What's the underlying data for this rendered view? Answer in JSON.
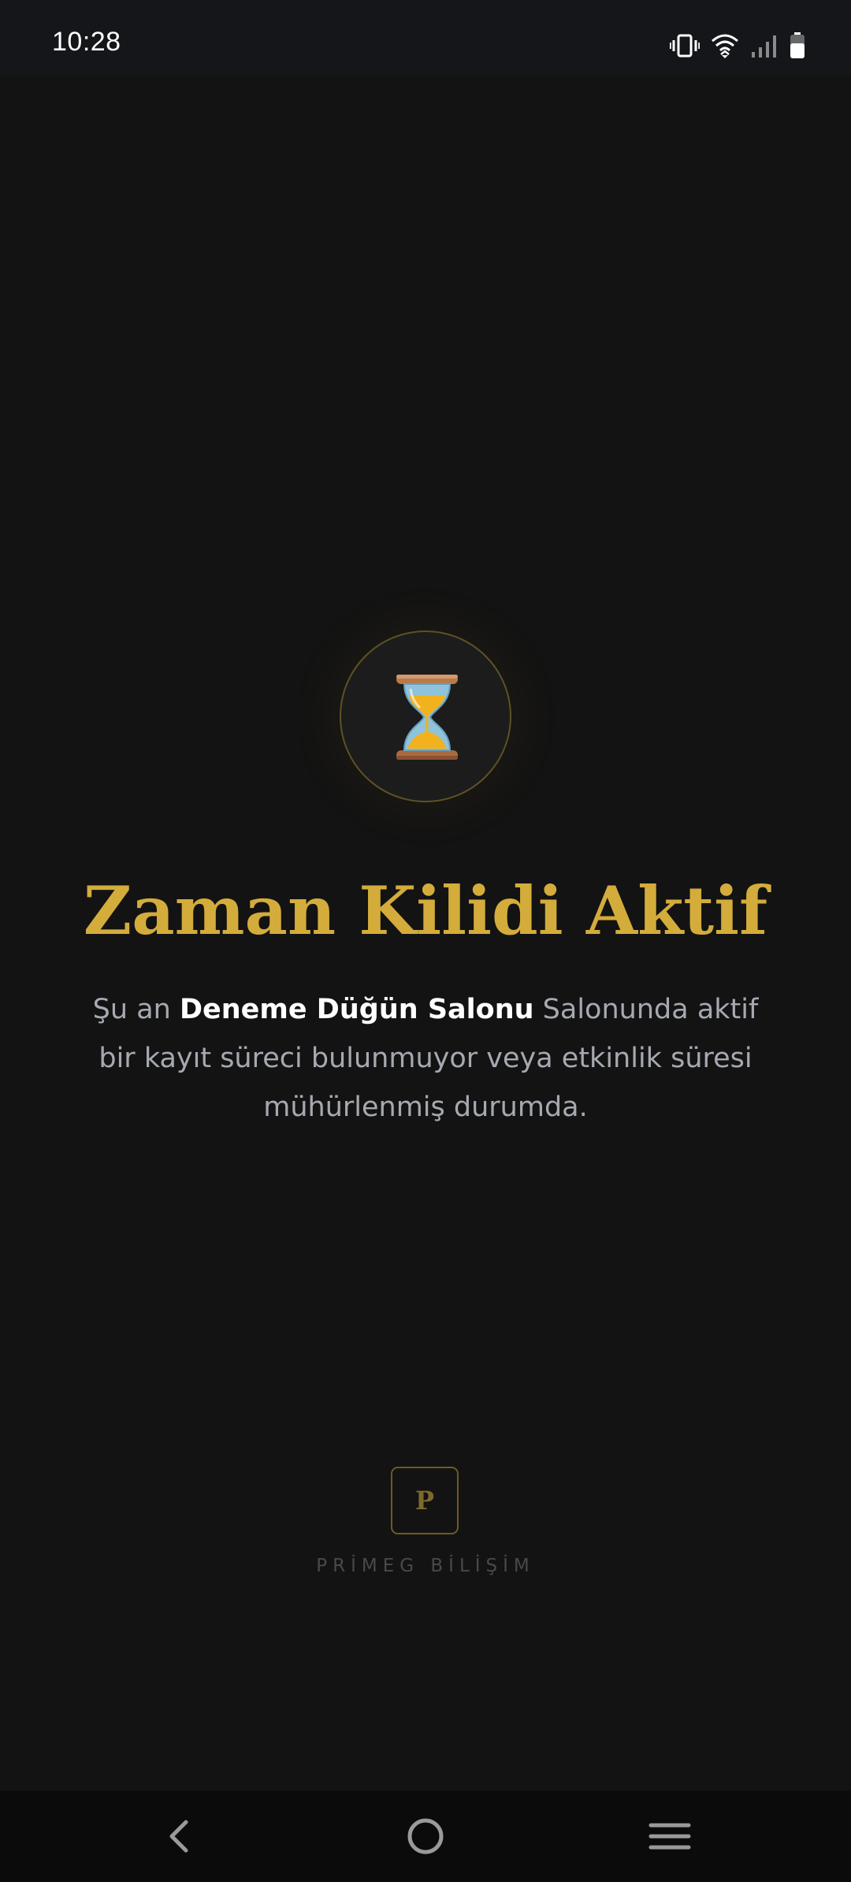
{
  "status_bar": {
    "time": "10:28",
    "icons": [
      "vibrate-icon",
      "wifi-icon",
      "signal-icon",
      "battery-icon"
    ]
  },
  "lock_screen": {
    "icon": "hourglass-icon",
    "title": "Zaman Kilidi Aktif",
    "message_prefix": "Şu an ",
    "venue_name": "Deneme Düğün Salonu",
    "message_suffix": " Salonunda aktif bir kayıt süreci bulunmuyor veya etkinlik süresi mühürlenmiş durumda."
  },
  "brand": {
    "logo_letter": "P",
    "name": "PRİMEG BİLİŞİM"
  },
  "nav_bar": {
    "buttons": [
      "back-icon",
      "home-icon",
      "recents-icon"
    ]
  },
  "colors": {
    "background": "#131313",
    "accent_gold": "#d3ac3b",
    "body_text": "#a6a9b1",
    "highlight_text": "#ffffff"
  }
}
